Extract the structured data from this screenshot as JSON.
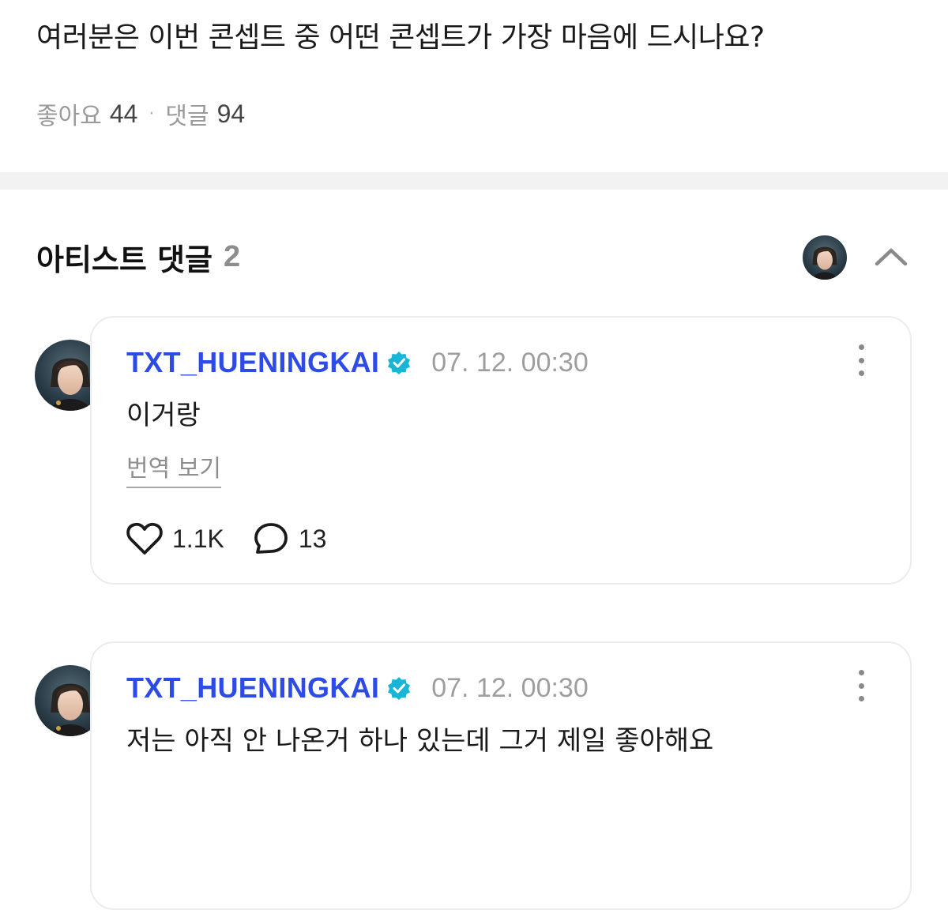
{
  "post": {
    "question": "여러분은 이번 콘셉트 중 어떤 콘셉트가 가장 마음에 드시나요?",
    "likes_label": "좋아요",
    "likes_count": "44",
    "separator": "·",
    "comments_label": "댓글",
    "comments_count": "94"
  },
  "artist_comments": {
    "title": "아티스트 댓글",
    "count": "2",
    "collapse_icon": "chevron-up-icon"
  },
  "comments": [
    {
      "author": "TXT_HUENINGKAI",
      "verified_icon": "verified-badge-icon",
      "time": "07. 12. 00:30",
      "text": "이거랑",
      "translate_label": "번역 보기",
      "like_count": "1.1K",
      "reply_count": "13"
    },
    {
      "author": "TXT_HUENINGKAI",
      "verified_icon": "verified-badge-icon",
      "time": "07. 12. 00:30",
      "text": "저는 아직 안 나온거 하나 있는데 그거 제일 좋아해요"
    }
  ],
  "colors": {
    "author_name": "#2d4be5",
    "verified_badge": "#19b5d6",
    "muted_text": "#9a9a9a",
    "section_divider": "#f2f2f2"
  }
}
